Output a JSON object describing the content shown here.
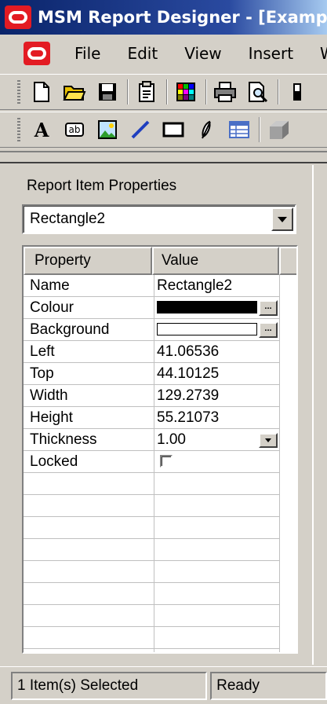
{
  "window": {
    "title": "MSM Report Designer - [Example"
  },
  "menu": {
    "items": [
      "File",
      "Edit",
      "View",
      "Insert",
      "W"
    ]
  },
  "toolbar1": {
    "icons": [
      "new-file-icon",
      "open-folder-icon",
      "save-icon",
      "properties-icon",
      "color-grid-icon",
      "print-icon",
      "print-preview-icon"
    ]
  },
  "toolbar2": {
    "icons": [
      "text-tool-icon",
      "textbox-tool-icon",
      "image-tool-icon",
      "line-tool-icon",
      "rectangle-tool-icon",
      "ellipse-tool-icon",
      "table-tool-icon",
      "3d-box-icon"
    ],
    "text_tool_label": "A",
    "textbox_tool_label": "ab"
  },
  "panel": {
    "label": "Report Item Properties",
    "selected_item": "Rectangle2"
  },
  "grid": {
    "headers": {
      "property": "Property",
      "value": "Value"
    },
    "rows": [
      {
        "name": "Name",
        "value": "Rectangle2"
      },
      {
        "name": "Colour",
        "value": "",
        "swatch": "#000000"
      },
      {
        "name": "Background",
        "value": "",
        "swatch": "#ffffff"
      },
      {
        "name": "Left",
        "value": "41.06536"
      },
      {
        "name": "Top",
        "value": "44.10125"
      },
      {
        "name": "Width",
        "value": "129.2739"
      },
      {
        "name": "Height",
        "value": "55.21073"
      },
      {
        "name": "Thickness",
        "value": "1.00"
      },
      {
        "name": "Locked",
        "value": "",
        "checked": false
      }
    ],
    "ellipsis_label": "..."
  },
  "status": {
    "selection": "1 Item(s) Selected",
    "state": "Ready"
  },
  "colors": {
    "titlebar_start": "#0a246a",
    "oracle_red": "#e31b23",
    "chrome": "#d4d0c8"
  }
}
